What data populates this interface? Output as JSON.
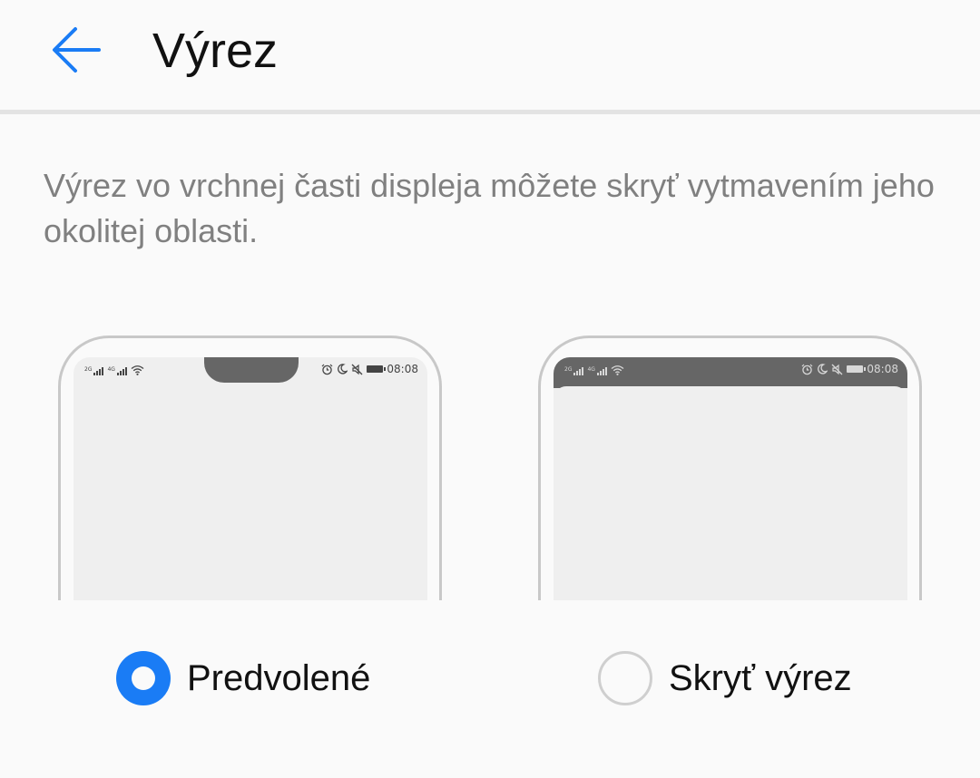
{
  "header": {
    "title": "Výrez",
    "back_icon": "arrow-left-icon"
  },
  "description": "Výrez vo vrchnej časti displeja môžete skryť vytmavením jeho okolitej oblasti.",
  "previews": {
    "default": {
      "signal_1_tag": "2G",
      "signal_2_tag": "4G",
      "time": "08:08"
    },
    "hidden": {
      "signal_1_tag": "2G",
      "signal_2_tag": "4G",
      "time": "08:08"
    }
  },
  "options": [
    {
      "label": "Predvolené",
      "selected": true
    },
    {
      "label": "Skryť výrez",
      "selected": false
    }
  ],
  "colors": {
    "accent": "#1a7cf5",
    "background": "#fafafa",
    "notch": "#666666",
    "description_text": "#808080"
  }
}
